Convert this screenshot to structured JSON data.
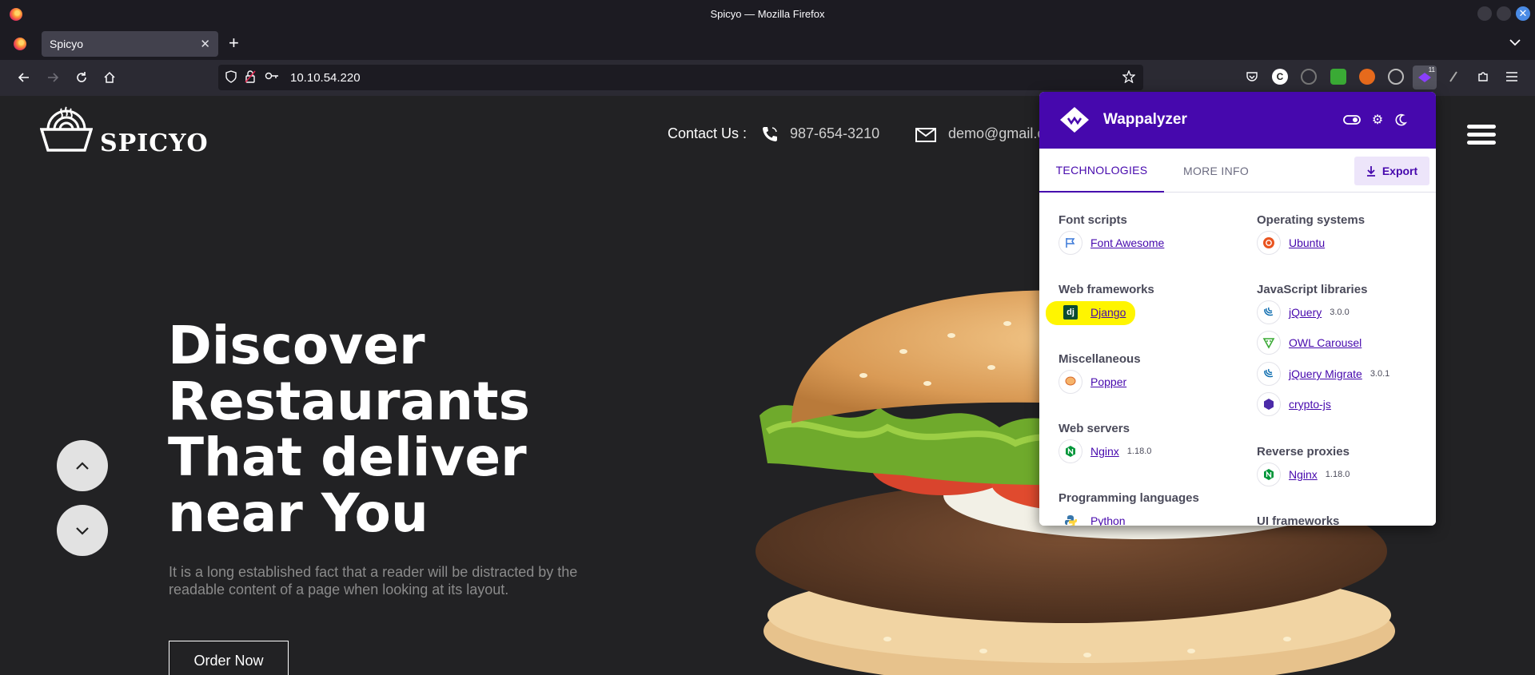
{
  "window": {
    "title": "Spicyo — Mozilla Firefox"
  },
  "tabs": [
    {
      "label": "Spicyo"
    }
  ],
  "navbar": {
    "url": "10.10.54.220"
  },
  "extensions": {
    "wappalyzer_badge": "11"
  },
  "site": {
    "logo_text": "SPICYO",
    "contact_label": "Contact Us :",
    "phone": "987-654-3210",
    "email": "demo@gmail.c",
    "hero_lines": [
      "Discover",
      "Restaurants",
      "That deliver",
      "near You"
    ],
    "hero_sub": "It is a long established fact that a reader will be distracted by the readable content of a page when looking at its layout.",
    "order_button": "Order Now"
  },
  "wappalyzer": {
    "title": "Wappalyzer",
    "tab_technologies": "TECHNOLOGIES",
    "tab_more_info": "MORE INFO",
    "export_label": "Export",
    "left_column": [
      {
        "category": "Font scripts",
        "items": [
          {
            "name": "Font Awesome",
            "version": "",
            "icon": "font-awesome-icon"
          }
        ]
      },
      {
        "category": "Web frameworks",
        "items": [
          {
            "name": "Django",
            "version": "",
            "icon": "django-icon",
            "highlighted": true
          }
        ]
      },
      {
        "category": "Miscellaneous",
        "items": [
          {
            "name": "Popper",
            "version": "",
            "icon": "popper-icon"
          }
        ]
      },
      {
        "category": "Web servers",
        "items": [
          {
            "name": "Nginx",
            "version": "1.18.0",
            "icon": "nginx-icon"
          }
        ]
      },
      {
        "category": "Programming languages",
        "items": [
          {
            "name": "Python",
            "version": "",
            "icon": "python-icon"
          }
        ]
      }
    ],
    "right_column": [
      {
        "category": "Operating systems",
        "items": [
          {
            "name": "Ubuntu",
            "version": "",
            "icon": "ubuntu-icon"
          }
        ]
      },
      {
        "category": "JavaScript libraries",
        "items": [
          {
            "name": "jQuery",
            "version": "3.0.0",
            "icon": "jquery-icon"
          },
          {
            "name": "OWL Carousel",
            "version": "",
            "icon": "owl-carousel-icon"
          },
          {
            "name": "jQuery Migrate",
            "version": "3.0.1",
            "icon": "jquery-migrate-icon"
          },
          {
            "name": "crypto-js",
            "version": "",
            "icon": "crypto-js-icon"
          }
        ]
      },
      {
        "category": "Reverse proxies",
        "items": [
          {
            "name": "Nginx",
            "version": "1.18.0",
            "icon": "nginx-icon"
          }
        ]
      },
      {
        "category": "UI frameworks",
        "items": []
      }
    ]
  }
}
